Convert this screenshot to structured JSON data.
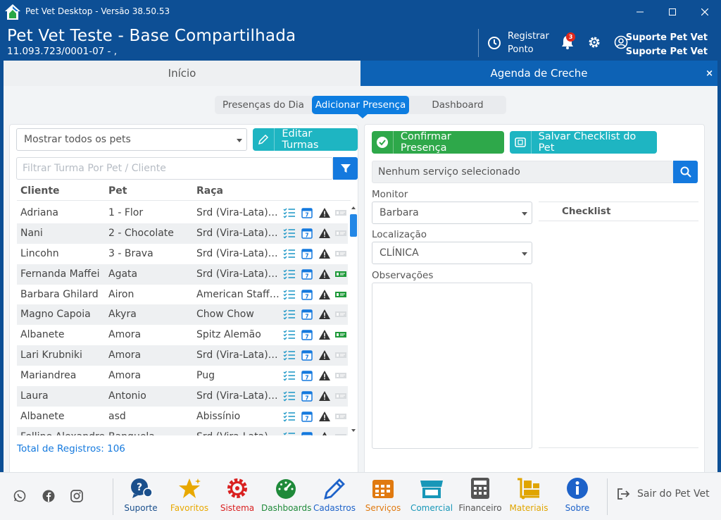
{
  "window": {
    "title": "Pet Vet Desktop - Versão 38.50.53"
  },
  "header": {
    "company": "Pet Vet Teste - Base Compartilhada",
    "cnpj": "11.093.723/0001-07 -  ,",
    "ponto_line1": "Registrar",
    "ponto_line2": "Ponto",
    "notifications": "3",
    "user_line1": "Suporte Pet Vet",
    "user_line2": "Suporte Pet Vet"
  },
  "tabs": {
    "inicio": "Início",
    "agenda": "Agenda de Creche",
    "close": "×"
  },
  "subtabs": {
    "presencas": "Presenças do Dia",
    "adicionar": "Adicionar Presença",
    "dashboard": "Dashboard"
  },
  "left": {
    "pets_select": "Mostrar todos os pets",
    "editar_turmas": "Editar Turmas",
    "filter_placeholder": "Filtrar Turma Por Pet / Cliente",
    "columns": {
      "cliente": "Cliente",
      "pet": "Pet",
      "raca": "Raça"
    },
    "rows": [
      {
        "cliente": "Adriana",
        "pet": "1 - Flor",
        "raca": "Srd (Vira-Lata) C...",
        "money": false
      },
      {
        "cliente": "Nani",
        "pet": "2 - Chocolate",
        "raca": "Srd (Vira-Lata) C...",
        "money": false
      },
      {
        "cliente": "Lincohn",
        "pet": "3 - Brava",
        "raca": "Srd (Vira-Lata) C...",
        "money": false
      },
      {
        "cliente": "Fernanda Maffei",
        "pet": "Agata",
        "raca": "Srd (Vira-Lata) C...",
        "money": true
      },
      {
        "cliente": "Barbara Ghilard",
        "pet": "Airon",
        "raca": "American Staffo...",
        "money": true
      },
      {
        "cliente": "Magno Capoia",
        "pet": "Akyra",
        "raca": "Chow Chow",
        "money": false
      },
      {
        "cliente": "Albanete",
        "pet": "Amora",
        "raca": "Spitz Alemão",
        "money": true
      },
      {
        "cliente": "Lari Krubniki",
        "pet": "Amora",
        "raca": "Srd (Vira-Lata) C...",
        "money": false
      },
      {
        "cliente": "Mariandrea",
        "pet": "Amora",
        "raca": "Pug",
        "money": false
      },
      {
        "cliente": "Laura",
        "pet": "Antonio",
        "raca": "Srd (Vira-Lata) C...",
        "money": false
      },
      {
        "cliente": "Albanete",
        "pet": "asd",
        "raca": "Abissínio",
        "money": false
      },
      {
        "cliente": "Felline Alexandre",
        "pet": "Banguela",
        "raca": "Srd (Vira-Lata) F...",
        "money": false
      }
    ],
    "total": "Total de Registros: 106"
  },
  "right": {
    "confirmar": "Confirmar Presença",
    "salvar": "Salvar Checklist do Pet",
    "servico_placeholder": "Nenhum serviço selecionado",
    "monitor_label": "Monitor",
    "monitor_value": "Barbara",
    "localizacao_label": "Localização",
    "localizacao_value": "CLÍNICA",
    "observacoes_label": "Observações",
    "checklist": "Checklist"
  },
  "footer": {
    "items": [
      {
        "label": "Suporte",
        "color": "#1a4f8c"
      },
      {
        "label": "Favoritos",
        "color": "#e8a800"
      },
      {
        "label": "Sistema",
        "color": "#d92020"
      },
      {
        "label": "Dashboards",
        "color": "#1f8a3a"
      },
      {
        "label": "Cadastros",
        "color": "#1d62c9"
      },
      {
        "label": "Serviços",
        "color": "#e07a10"
      },
      {
        "label": "Comercial",
        "color": "#1897b8"
      },
      {
        "label": "Financeiro",
        "color": "#555555"
      },
      {
        "label": "Materiais",
        "color": "#e0a500"
      },
      {
        "label": "Sobre",
        "color": "#1d62c9"
      }
    ],
    "logout": "Sair do Pet Vet"
  }
}
